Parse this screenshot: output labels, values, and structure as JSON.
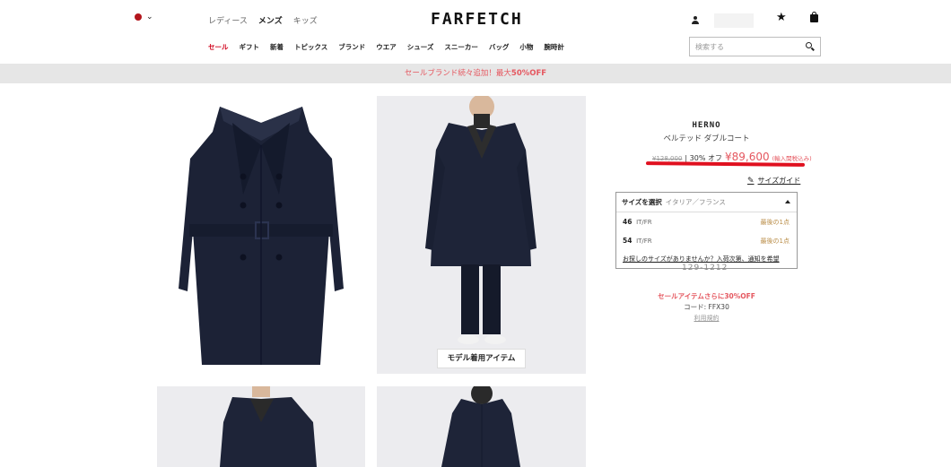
{
  "header": {
    "region_icon": "red-dot-flag-icon",
    "gender_tabs": [
      "レディース",
      "メンズ",
      "キッズ"
    ],
    "logo": "FARFETCH",
    "nav": [
      "セール",
      "ギフト",
      "新着",
      "トピックス",
      "ブランド",
      "ウエア",
      "シューズ",
      "スニーカー",
      "バッグ",
      "小物",
      "腕時計"
    ],
    "search_placeholder": "検索する",
    "star_glyph": "★"
  },
  "promo": {
    "text": "セールブランド続々追加！最大",
    "highlight": "50%OFF"
  },
  "gallery": {
    "model_badge": "モデル着用アイテム"
  },
  "product": {
    "brand": "HERNO",
    "name": "ベルテッド ダブルコート",
    "old_price": "¥128,000",
    "discount": "| 30% オフ",
    "new_price": "¥89,600",
    "tax_note": "(輸入関税込み)",
    "size_guide": "サイズガイド",
    "pencil_glyph": "✎"
  },
  "size_selector": {
    "label": "サイズを選択",
    "sub_label": "イタリア／フランス",
    "options": [
      {
        "size": "46",
        "unit": "IT/FR",
        "stock": "最後の1点"
      },
      {
        "size": "54",
        "unit": "IT/FR",
        "stock": "最後の1点"
      }
    ],
    "notify_text": "お探しのサイズがありませんか？入荷次第、通知を希望"
  },
  "code_partial": "129-1212",
  "sale_extra": "セールアイテムさらに30%OFF",
  "promo_code": "コード: FFX30",
  "terms": "利用規約",
  "colors": {
    "accent": "#e5575f",
    "annotation": "#e0101f",
    "coat": "#1c2236",
    "stock": "#b98c46"
  }
}
